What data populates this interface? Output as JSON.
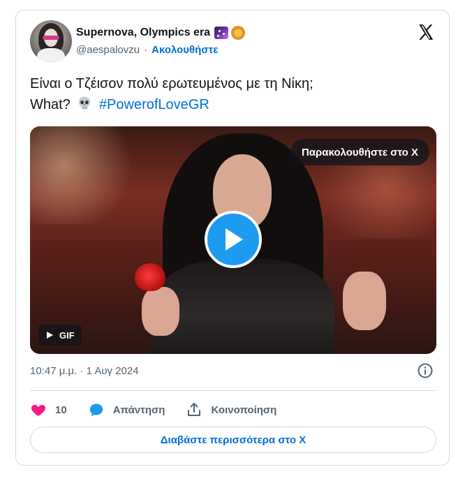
{
  "author": {
    "display_name": "Supernova, Olympics era",
    "name_emojis": [
      "milky-way-emoji",
      "lion-emoji"
    ],
    "handle": "@aespalovzu",
    "separator": "·",
    "follow_label": "Ακολουθήστε"
  },
  "tweet": {
    "line1": "Είναι ο Τζέισον πολύ ερωτευμένος με τη Νίκη;",
    "line2_prefix": "What?",
    "line2_emoji": "skull-emoji",
    "hashtag": "#PowerofLoveGR"
  },
  "media": {
    "watch_label": "Παρακολουθήστε στο Χ",
    "badge_label": "GIF"
  },
  "meta": {
    "timestamp": "10:47 μ.μ. · 1 Αυγ 2024"
  },
  "actions": {
    "like_count": "10",
    "reply_label": "Απάντηση",
    "share_label": "Κοινοποίηση"
  },
  "read_more_label": "Διαβάστε περισσότερα στο X",
  "colors": {
    "link_blue": "#006fd6",
    "play_blue": "#1d9bf0",
    "like_pink": "#f91880",
    "text_primary": "#0f1419",
    "text_secondary": "#536471",
    "border": "#cfd9de"
  }
}
